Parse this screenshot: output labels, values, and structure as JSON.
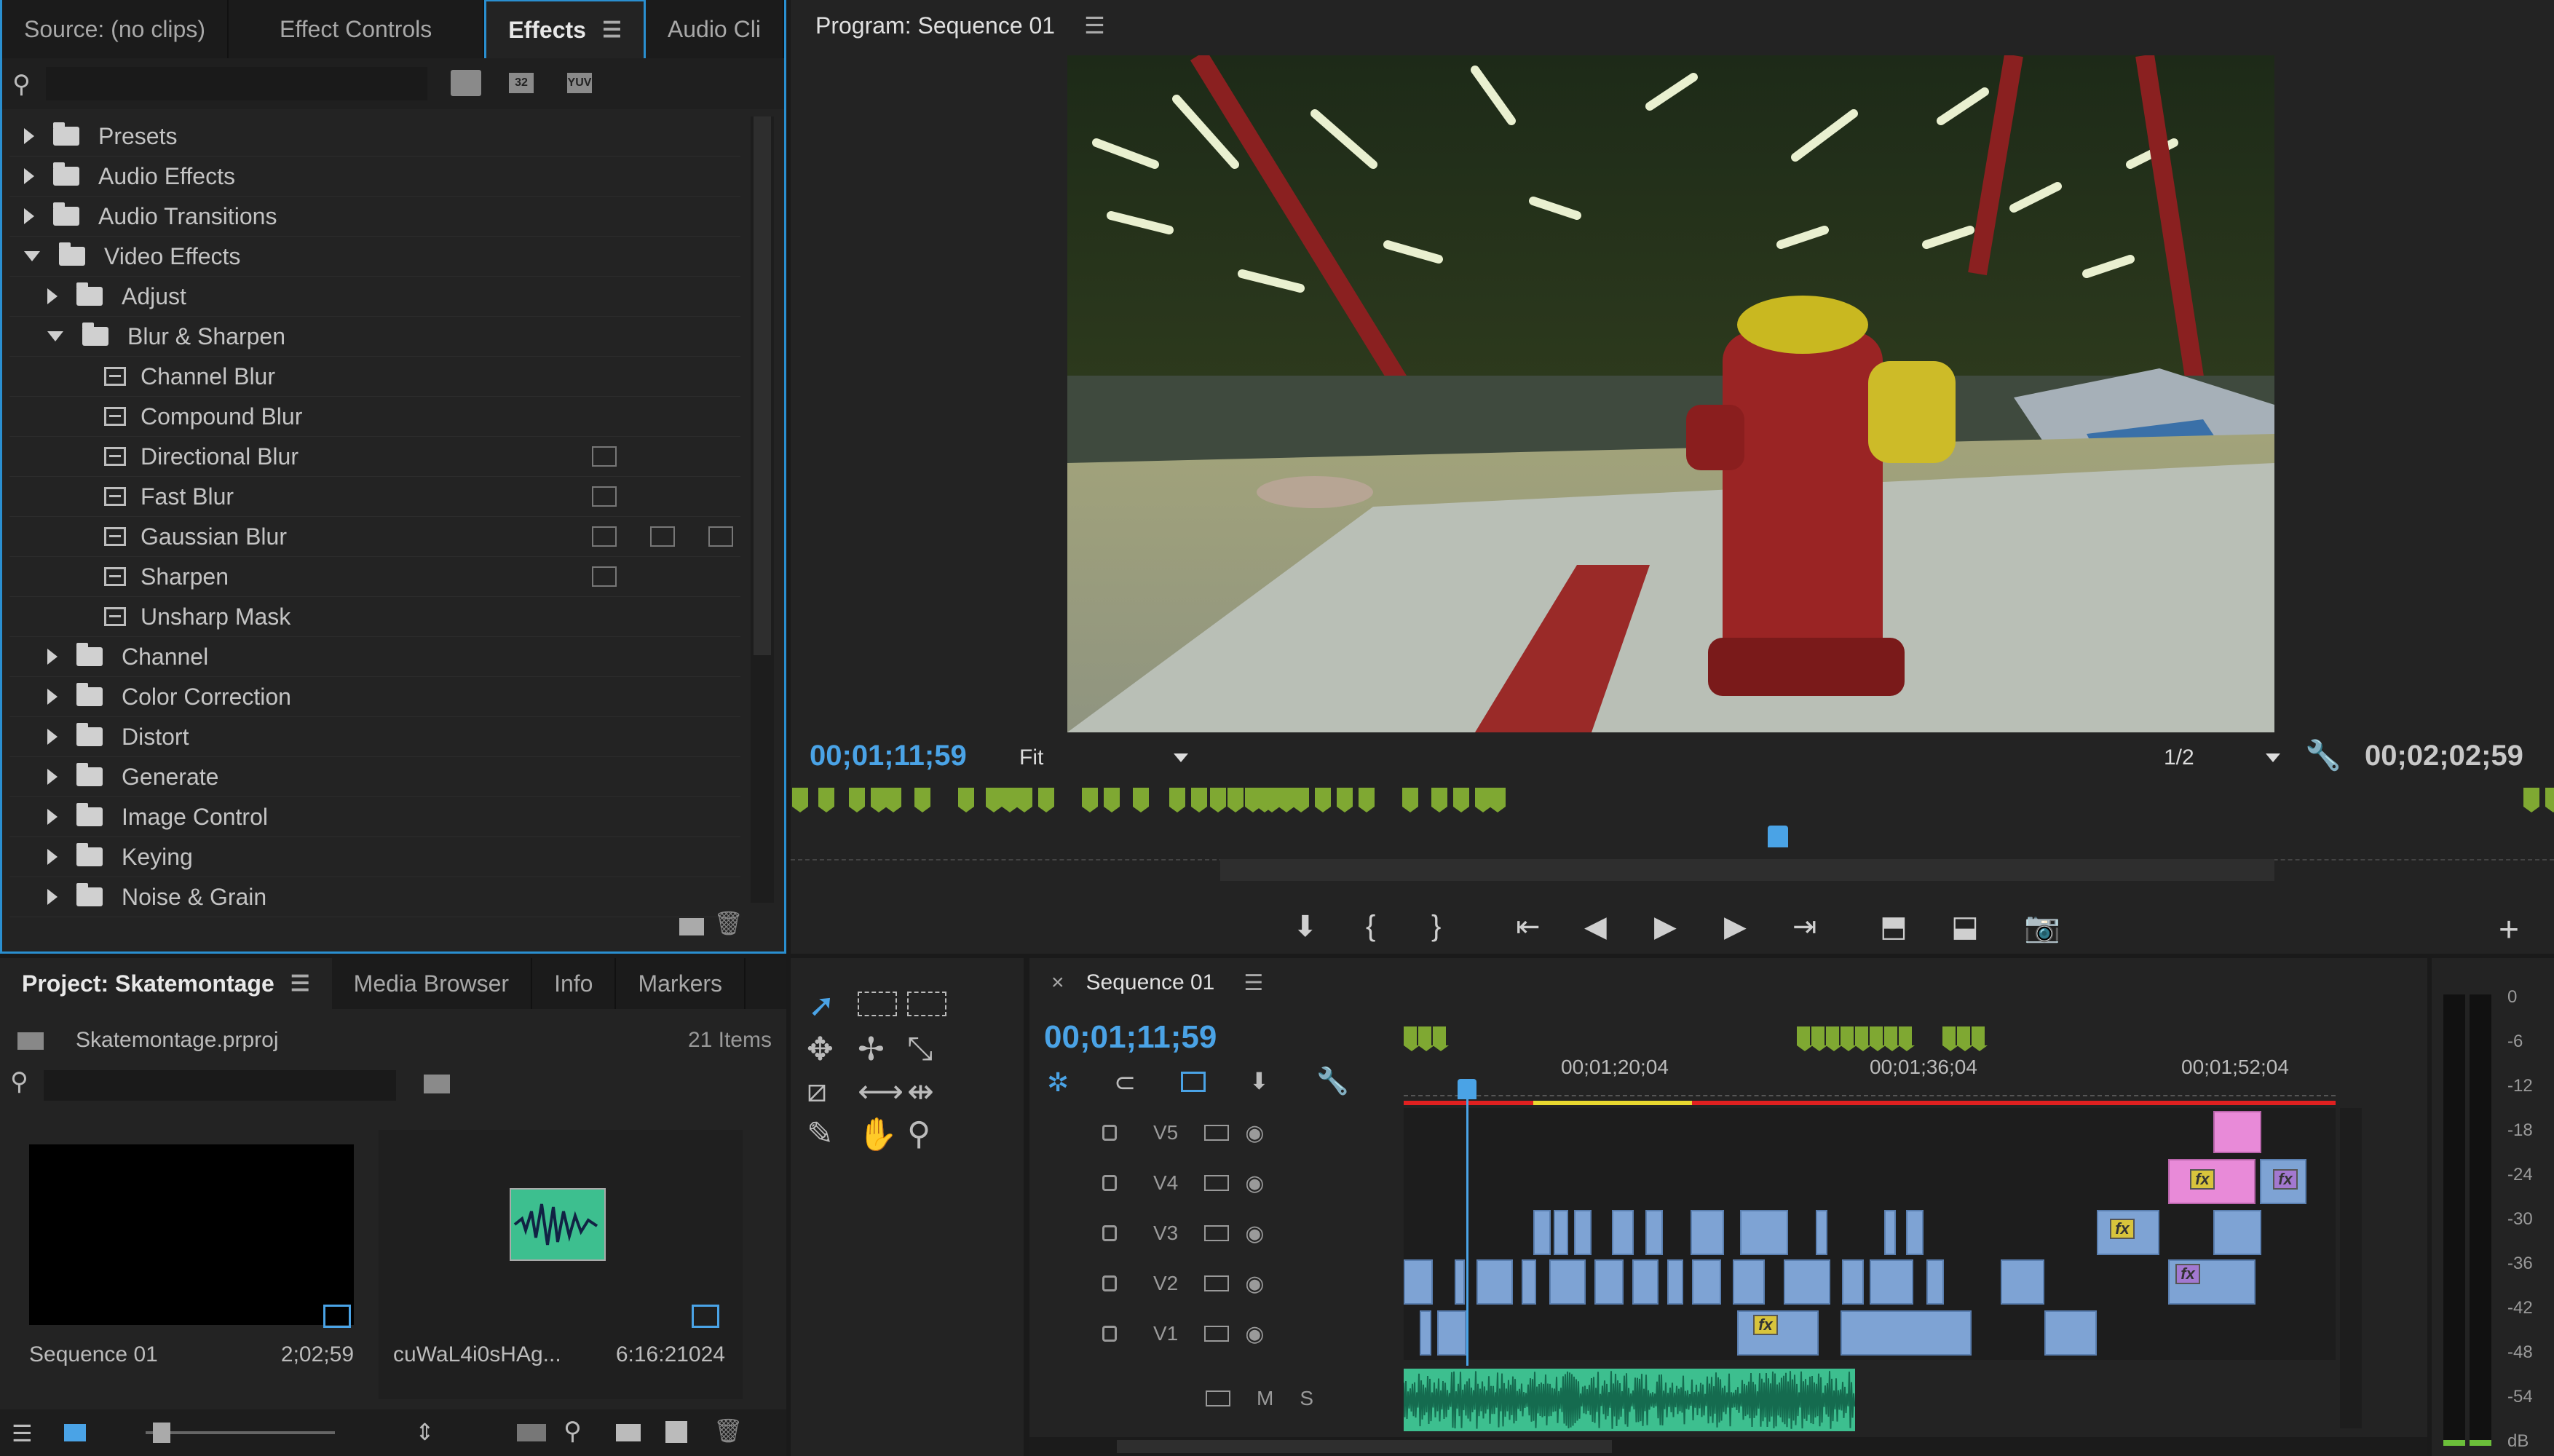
{
  "effects_panel": {
    "tabs": [
      {
        "label": "Source: (no clips)"
      },
      {
        "label": "Effect Controls"
      },
      {
        "label": "Effects",
        "active": true
      },
      {
        "label": "Audio Cli"
      }
    ],
    "search_placeholder": "",
    "filter_badges": [
      "32",
      "YUV"
    ],
    "tree": [
      {
        "label": "Presets",
        "type": "folder",
        "expanded": false
      },
      {
        "label": "Audio Effects",
        "type": "folder",
        "expanded": false
      },
      {
        "label": "Audio Transitions",
        "type": "folder",
        "expanded": false
      },
      {
        "label": "Video Effects",
        "type": "folder",
        "expanded": true
      },
      {
        "label": "Adjust",
        "type": "folder",
        "expanded": false
      },
      {
        "label": "Blur & Sharpen",
        "type": "folder",
        "expanded": true
      },
      {
        "label": "Channel Blur",
        "type": "effect"
      },
      {
        "label": "Compound Blur",
        "type": "effect"
      },
      {
        "label": "Directional Blur",
        "type": "effect"
      },
      {
        "label": "Fast Blur",
        "type": "effect"
      },
      {
        "label": "Gaussian Blur",
        "type": "effect"
      },
      {
        "label": "Sharpen",
        "type": "effect"
      },
      {
        "label": "Unsharp Mask",
        "type": "effect"
      },
      {
        "label": "Channel",
        "type": "folder",
        "expanded": false
      },
      {
        "label": "Color Correction",
        "type": "folder",
        "expanded": false
      },
      {
        "label": "Distort",
        "type": "folder",
        "expanded": false
      },
      {
        "label": "Generate",
        "type": "folder",
        "expanded": false
      },
      {
        "label": "Image Control",
        "type": "folder",
        "expanded": false
      },
      {
        "label": "Keying",
        "type": "folder",
        "expanded": false
      },
      {
        "label": "Noise & Grain",
        "type": "folder",
        "expanded": false
      }
    ]
  },
  "program_monitor": {
    "title": "Program: Sequence 01",
    "current_timecode": "00;01;11;59",
    "zoom": "Fit",
    "resolution": "1/2",
    "duration": "00;02;02;59"
  },
  "project_panel": {
    "tabs": [
      {
        "label": "Project: Skatemontage",
        "active": true
      },
      {
        "label": "Media Browser"
      },
      {
        "label": "Info"
      },
      {
        "label": "Markers"
      }
    ],
    "project_file": "Skatemontage.prproj",
    "item_count": "21 Items",
    "items": [
      {
        "name": "Sequence 01",
        "duration": "2;02;59"
      },
      {
        "name": "cuWaL4i0sHAg...",
        "duration": "6:16:21024"
      }
    ]
  },
  "timeline": {
    "tab": "Sequence 01",
    "timecode": "00;01;11;59",
    "ruler_labels": [
      "00;01;20;04",
      "00;01;36;04",
      "00;01;52;04"
    ],
    "tracks": [
      {
        "label": "V5"
      },
      {
        "label": "V4"
      },
      {
        "label": "V3"
      },
      {
        "label": "V2"
      },
      {
        "label": "V1"
      }
    ],
    "audio_track": {
      "m": "M",
      "s": "S"
    }
  },
  "audio_meter": {
    "scale": [
      "0",
      "-6",
      "-12",
      "-18",
      "-24",
      "-30",
      "-36",
      "-42",
      "-48",
      "-54",
      "dB"
    ]
  },
  "colors": {
    "accent": "#2a8fd0",
    "timecode": "#4aa3e6",
    "marker": "#7fa832",
    "clip_video": "#7ea3d4",
    "clip_pink": "#e88ad8",
    "audio_clip": "#3dbf8f"
  }
}
